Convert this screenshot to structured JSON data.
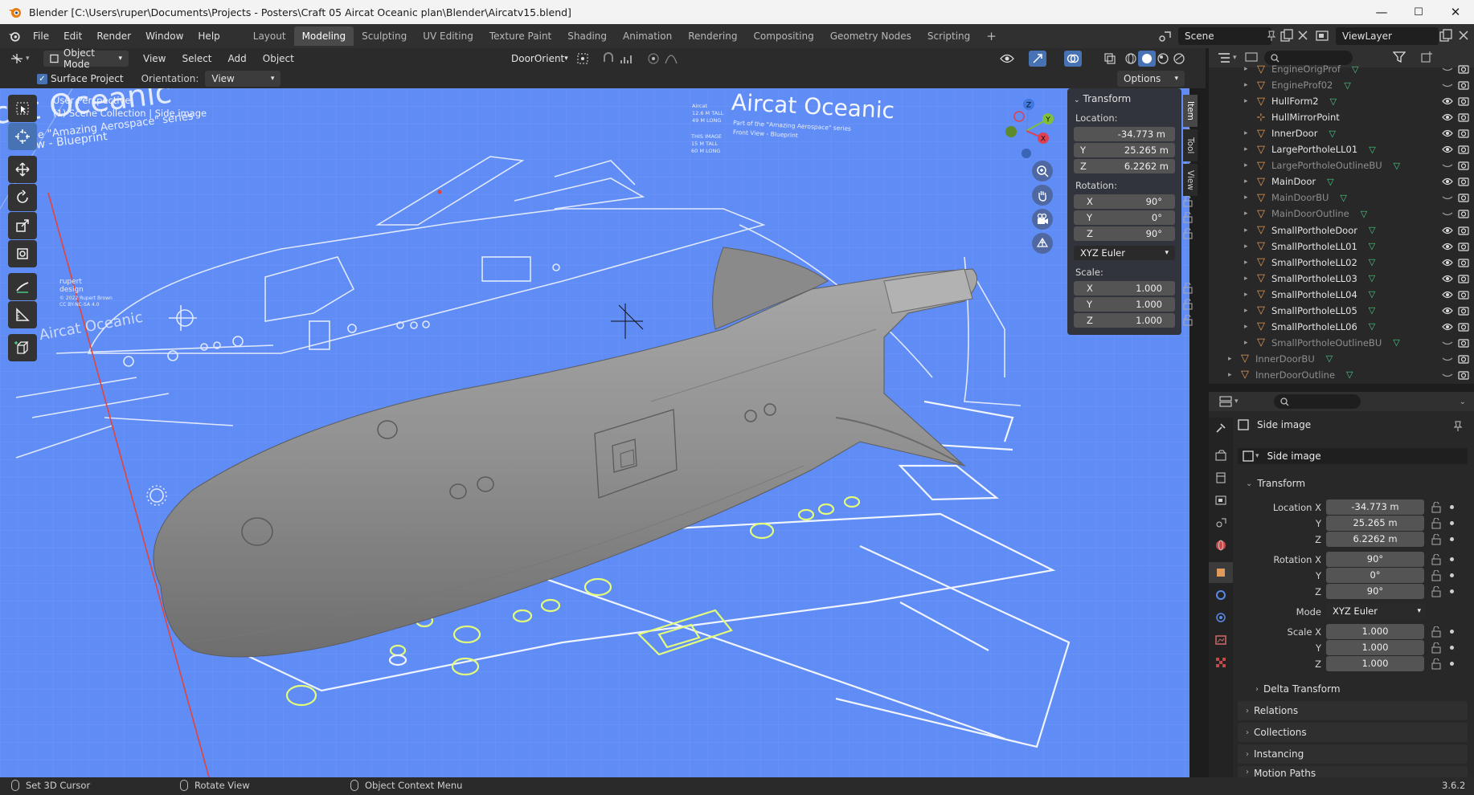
{
  "window": {
    "title": "Blender [C:\\Users\\ruper\\Documents\\Projects - Posters\\Craft 05 Aircat Oceanic plan\\Blender\\Aircatv15.blend]",
    "minimize": "—",
    "maximize": "☐",
    "close": "✕"
  },
  "menu": [
    "File",
    "Edit",
    "Render",
    "Window",
    "Help"
  ],
  "workspaces": [
    "Layout",
    "Modeling",
    "Sculpting",
    "UV Editing",
    "Texture Paint",
    "Shading",
    "Animation",
    "Rendering",
    "Compositing",
    "Geometry Nodes",
    "Scripting"
  ],
  "workspace_add": "+",
  "scene": {
    "name": "Scene",
    "view_layer": "ViewLayer"
  },
  "viewport_header": {
    "mode": "Object Mode",
    "menus": [
      "View",
      "Select",
      "Add",
      "Object"
    ],
    "orientation_preset": "DoorOrient",
    "surface_project": "Surface Project",
    "orientation_label": "Orientation:",
    "orientation_value": "View",
    "options": "Options"
  },
  "viewport": {
    "perspective": "User Perspective",
    "collection": "(1) Scene Collection | Side image",
    "blueprint_title": "Aircat Oceanic",
    "blueprint_sub1": "Part of the \"Amazing Aerospace\" series",
    "blueprint_sub2": "Front View - Blueprint",
    "blueprint_left_title": "cat Oceanic",
    "blueprint_left_sub1": "he \"Amazing Aerospace\" series",
    "blueprint_left_sub2": "ew - Blueprint",
    "spec1": "Aircat",
    "spec2": "12.6 M TALL",
    "spec3": "49 M LONG",
    "spec4": "THIS IMAGE",
    "spec5": "15 M TALL",
    "spec6": "60 M LONG",
    "credit1": "rupert",
    "credit2": "design",
    "credit3": "© 2022 Rupert Brown",
    "credit4": "CC BY-NC-SA 4.0",
    "wing_text": "Aircat Oceanic"
  },
  "gizmo": {
    "x": "X",
    "y": "Y",
    "z": "Z"
  },
  "npanel": {
    "tabs": [
      "Item",
      "Tool",
      "View"
    ],
    "section": "Transform",
    "location_label": "Location:",
    "location": [
      "-34.773 m",
      "25.265 m",
      "6.2262 m"
    ],
    "rotation_label": "Rotation:",
    "rotation": [
      "90°",
      "0°",
      "90°"
    ],
    "rotation_mode": "XYZ Euler",
    "scale_label": "Scale:",
    "scale": [
      "1.000",
      "1.000",
      "1.000"
    ],
    "axes": [
      "X",
      "Y",
      "Z"
    ]
  },
  "outliner": {
    "items": [
      {
        "name": "EngineOrigProf",
        "dim": true
      },
      {
        "name": "EngineProf02",
        "dim": true
      },
      {
        "name": "HullForm2",
        "dim": false
      },
      {
        "name": "HullMirrorPoint",
        "dim": false
      },
      {
        "name": "InnerDoor",
        "dim": false
      },
      {
        "name": "LargePortholeLL01",
        "dim": false
      },
      {
        "name": "LargePortholeOutlineBU",
        "dim": true
      },
      {
        "name": "MainDoor",
        "dim": false
      },
      {
        "name": "MainDoorBU",
        "dim": true
      },
      {
        "name": "MainDoorOutline",
        "dim": true
      },
      {
        "name": "SmallPortholeDoor",
        "dim": false
      },
      {
        "name": "SmallPortholeLL01",
        "dim": false
      },
      {
        "name": "SmallPortholeLL02",
        "dim": false
      },
      {
        "name": "SmallPortholeLL03",
        "dim": false
      },
      {
        "name": "SmallPortholeLL04",
        "dim": false
      },
      {
        "name": "SmallPortholeLL05",
        "dim": false
      },
      {
        "name": "SmallPortholeLL06",
        "dim": false
      },
      {
        "name": "SmallPortholeOutlineBU",
        "dim": true
      },
      {
        "name": "InnerDoorBU",
        "dim": true
      },
      {
        "name": "InnerDoorOutline",
        "dim": true
      }
    ]
  },
  "properties": {
    "object_name": "Side image",
    "data_name": "Side image",
    "transform_section": "Transform",
    "location_labels": [
      "Location X",
      "Y",
      "Z"
    ],
    "location": [
      "-34.773 m",
      "25.265 m",
      "6.2262 m"
    ],
    "rotation_labels": [
      "Rotation X",
      "Y",
      "Z"
    ],
    "rotation": [
      "90°",
      "0°",
      "90°"
    ],
    "mode_label": "Mode",
    "mode_value": "XYZ Euler",
    "scale_labels": [
      "Scale X",
      "Y",
      "Z"
    ],
    "scale": [
      "1.000",
      "1.000",
      "1.000"
    ],
    "delta_transform": "Delta Transform",
    "sections": [
      "Relations",
      "Collections",
      "Instancing",
      "Motion Paths"
    ]
  },
  "statusbar": {
    "left": "Set 3D Cursor",
    "middle": "Rotate View",
    "right": "Object Context Menu",
    "version": "3.6.2"
  },
  "colors": {
    "viewport_blue": "#5f8cf5",
    "accent": "#4772b3",
    "object_orange": "#e09a5a",
    "mesh_green": "#4ec785"
  }
}
